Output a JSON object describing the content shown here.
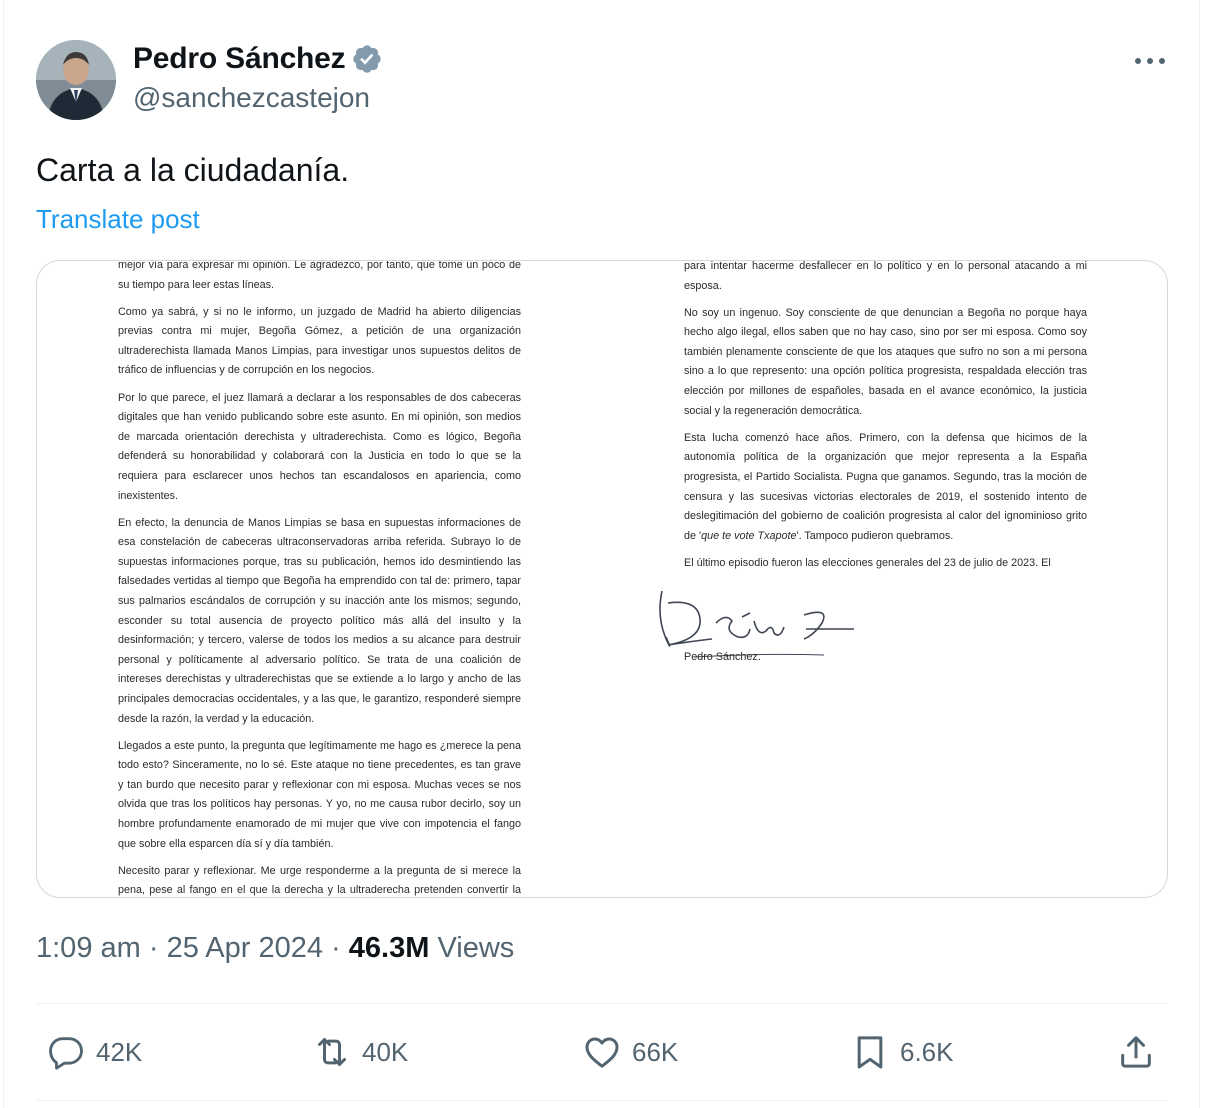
{
  "author": {
    "display_name": "Pedro Sánchez",
    "handle": "@sanchezcastejon",
    "verified": true,
    "verified_color": "#829aab"
  },
  "post": {
    "text": "Carta a la ciudadanía.",
    "translate_label": "Translate post"
  },
  "letter": {
    "left_column": [
      "mejor vía para expresar mi opinión. Le agradezco, por tanto, que tome un poco de su tiempo para leer estas líneas.",
      "Como ya sabrá, y si no le informo, un juzgado de Madrid ha abierto diligencias previas contra mi mujer, Begoña Gómez, a petición de una organización ultraderechista llamada Manos Limpias, para investigar unos supuestos delitos de tráfico de influencias y de corrupción en los negocios.",
      "Por lo que parece, el juez llamará a declarar a los responsables de dos cabeceras digitales que han venido publicando sobre este asunto. En mi opinión, son medios de marcada orientación derechista y ultraderechista. Como es lógico, Begoña defenderá su honorabilidad y colaborará con la Justicia en todo lo que se la requiera para esclarecer unos hechos tan escandalosos en apariencia, como inexistentes.",
      "En efecto, la denuncia de Manos Limpias se basa en supuestas informaciones de esa constelación de cabeceras ultraconservadoras arriba referida. Subrayo lo de supuestas informaciones porque, tras su publicación, hemos ido desmintiendo las falsedades vertidas al tiempo que Begoña ha emprendido con tal de: primero, tapar sus palmarios escándalos de corrupción y su inacción ante los mismos; segundo, esconder su total ausencia de proyecto político más allá del insulto y la desinformación; y tercero, valerse de todos los medios a su alcance para destruir personal y políticamente al adversario político. Se trata de una coalición de intereses derechistas y ultraderechistas que se extiende a lo largo y ancho de las principales democracias occidentales, y a las que, le garantizo, responderé siempre desde la razón, la verdad y la educación.",
      "Llegados a este punto, la pregunta que legítimamente me hago es ¿merece la pena todo esto? Sinceramente, no lo sé. Este ataque no tiene precedentes, es tan grave y tan burdo que necesito parar y reflexionar con mi esposa. Muchas veces se nos olvida que tras los políticos hay personas. Y yo, no me causa rubor decirlo, soy un hombre profundamente enamorado de mi mujer que vive con impotencia el fango que sobre ella esparcen día sí y día también.",
      "Necesito parar y reflexionar. Me urge responderme a la pregunta de si merece la pena, pese al fango en el que la derecha y la ultraderecha pretenden convertir la política. Si debo continuar al frente del Gobierno o renunciar a este alto honor. A"
    ],
    "right_column_intro": "para intentar hacerme desfallecer en lo político y en lo personal atacando a mi esposa.",
    "right_column_p2": "No soy un ingenuo. Soy consciente de que denuncian a Begoña no porque haya hecho algo ilegal, ellos saben que no hay caso, sino por ser mi esposa. Como soy también plenamente consciente de que los ataques que sufro no son a mi persona sino a lo que represento: una opción política progresista, respaldada elección tras elección por millones de españoles, basada en el avance económico, la justicia social y la regeneración democrática.",
    "right_column_p3_before": "Esta lucha comenzó hace años. Primero, con la defensa que hicimos de la autonomía política de la organización que mejor representa a la España progresista, el Partido Socialista. Pugna que ganamos. Segundo, tras la moción de censura y las sucesivas victorias electorales de 2019, el sostenido intento de deslegitimación del gobierno de coalición progresista al calor del ignominioso grito de '",
    "right_column_p3_quote": "que te vote Txapote",
    "right_column_p3_after": "'. Tampoco pudieron quebramos.",
    "right_column_p4": "El último episodio fueron las elecciones generales del 23 de julio de 2023. El",
    "signature_name": "Pedro Sánchez."
  },
  "meta": {
    "time": "1:09 am",
    "separator": " · ",
    "date": "25 Apr 2024",
    "views_count": "46.3M",
    "views_label": " Views"
  },
  "actions": {
    "replies": "42K",
    "reposts": "40K",
    "likes": "66K",
    "bookmarks": "6.6K"
  },
  "icons": {
    "verified": "verified-badge-icon",
    "more": "more-horizontal-icon",
    "reply": "reply-icon",
    "repost": "repost-icon",
    "like": "heart-icon",
    "bookmark": "bookmark-icon",
    "share": "share-icon"
  }
}
